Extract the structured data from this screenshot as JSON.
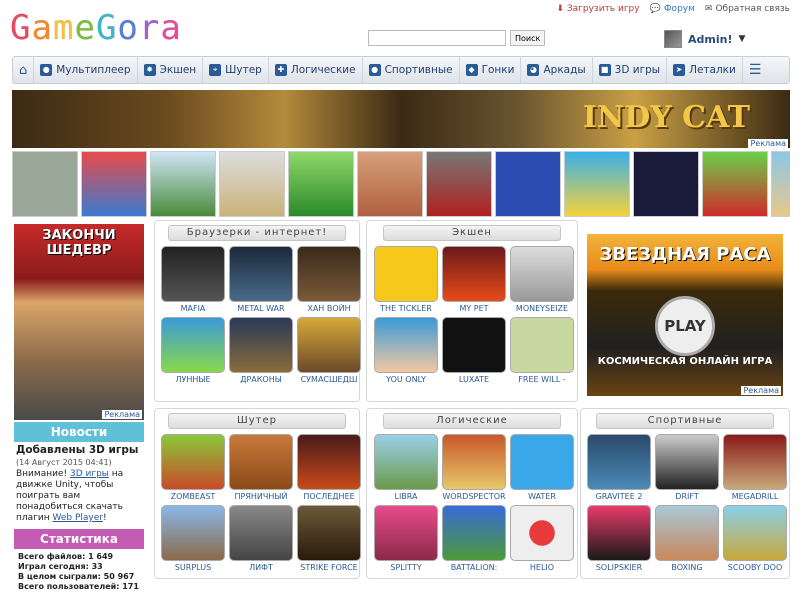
{
  "logo": "GameGora",
  "toplinks": [
    {
      "label": "Загрузить игру",
      "icon": "upload-icon"
    },
    {
      "label": "Форум",
      "icon": "chat-icon"
    },
    {
      "label": "Обратная связь",
      "icon": "mail-icon"
    }
  ],
  "search": {
    "button": "Поиск",
    "value": ""
  },
  "user": {
    "name": "Admin!"
  },
  "nav": [
    "Мультиплеер",
    "Экшен",
    "Шутер",
    "Логические",
    "Спортивные",
    "Гонки",
    "Аркады",
    "3D игры",
    "Леталки"
  ],
  "banner": {
    "title": "INDY CAT",
    "reklama": "Реклама"
  },
  "left_ad": {
    "title": "ЗАКОНЧИ ШЕДЕВР",
    "reklama": "Реклама"
  },
  "news": {
    "header": "Новости",
    "title": "Добавлены 3D игры",
    "date": "(14 Август 2015 04:41)",
    "text1": "Внимание!",
    "link1": "3D игры",
    "text2": "на движке Unity, чтобы поиграть вам понадобиться скачать плагин",
    "link2": "Web Player",
    "text3": "!"
  },
  "stats": {
    "header": "Статистика",
    "lines": [
      "Всего файлов: 1 649",
      "Играл сегодня: 33",
      "В целом сыграли: 50 967",
      "Всего пользователей: 171"
    ]
  },
  "right_ad": {
    "title": "ЗВЕЗДНАЯ РАСА",
    "play": "PLAY",
    "subtitle": "КОСМИЧЕСКАЯ ОНЛАЙН ИГРА",
    "reklama": "Реклама"
  },
  "panels": [
    {
      "title": "Браузерки - интернет!",
      "games": [
        "MAFIA",
        "METAL WAR",
        "ХАН ВОЙН",
        "ЛУННЫЕ",
        "ДРАКОНЫ",
        "СУМАСШЕДШ"
      ]
    },
    {
      "title": "Экшен",
      "games": [
        "THE TICKLER",
        "MY PET",
        "MONEYSEIZE",
        "YOU ONLY",
        "LUXATE",
        "FREE WILL -"
      ]
    },
    {
      "title": "Шутер",
      "games": [
        "ZOMBEAST",
        "ПРЯНИЧНЫЙ",
        "ПОСЛЕДНЕЕ",
        "SURPLUS",
        "ЛИФТ",
        "STRIKE FORCE"
      ]
    },
    {
      "title": "Логические",
      "games": [
        "LIBRA",
        "WORDSPECTOR",
        "WATER",
        "SPLITTY",
        "BATTALION:",
        "HELIO"
      ]
    },
    {
      "title": "Спортивные",
      "games": [
        "GRAVITEE 2",
        "DRIFT",
        "MEGADRILL",
        "SOLIPSKIER",
        "BOXING",
        "SCOOBY DOO"
      ]
    }
  ],
  "colors": {
    "nav_text": "#1f3f6b",
    "news_header": "#5fc0d8",
    "stats_header": "#c45cb6"
  }
}
